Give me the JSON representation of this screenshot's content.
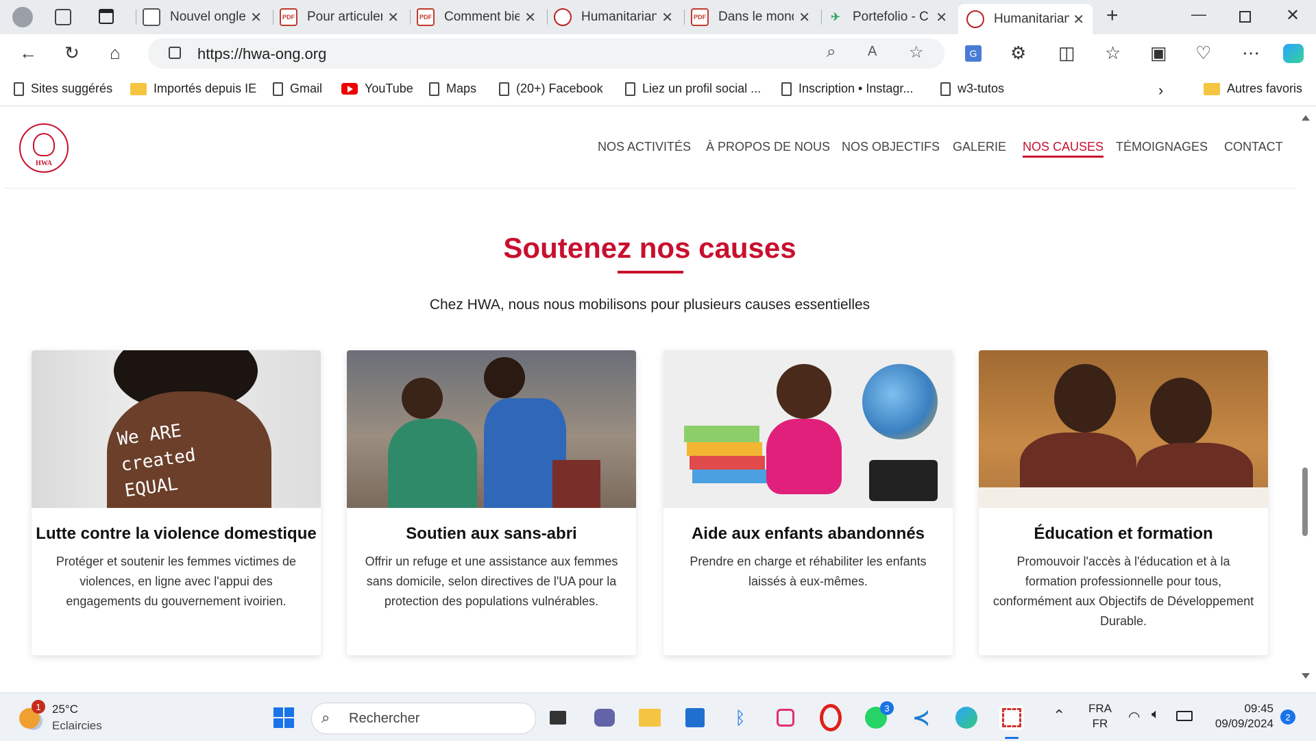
{
  "browser": {
    "tabs": [
      {
        "title": "Nouvel onglet",
        "icon": "new-tab-icon"
      },
      {
        "title": "Pour articuler",
        "icon": "pdf-icon"
      },
      {
        "title": "Comment bien",
        "icon": "pdf-icon"
      },
      {
        "title": "Humanitarian",
        "icon": "hwa-logo-icon"
      },
      {
        "title": "Dans le monde",
        "icon": "pdf-icon"
      },
      {
        "title": "Portefolio - C",
        "icon": "plane-icon"
      },
      {
        "title": "Humanitarian",
        "icon": "hwa-logo-icon",
        "active": true
      }
    ],
    "url": "https://hwa-ong.org",
    "bookmarks": [
      {
        "label": "Sites suggérés",
        "icon": "page-icon"
      },
      {
        "label": "Importés depuis IE",
        "icon": "folder-icon"
      },
      {
        "label": "Gmail",
        "icon": "page-icon"
      },
      {
        "label": "YouTube",
        "icon": "youtube-icon"
      },
      {
        "label": "Maps",
        "icon": "page-icon"
      },
      {
        "label": "(20+) Facebook",
        "icon": "page-icon"
      },
      {
        "label": "Liez un profil social ...",
        "icon": "page-icon"
      },
      {
        "label": "Inscription • Instagr...",
        "icon": "page-icon"
      },
      {
        "label": "w3-tutos",
        "icon": "page-icon"
      }
    ],
    "other_favorites": "Autres favoris"
  },
  "site": {
    "logo_text": "HWA",
    "nav": [
      "NOS ACTIVITÉS",
      "À PROPOS DE NOUS",
      "NOS OBJECTIFS",
      "GALERIE",
      "NOS CAUSES",
      "TÉMOIGNAGES",
      "CONTACT"
    ],
    "active_nav": "NOS CAUSES",
    "section_title": "Soutenez nos causes",
    "section_subtitle": "Chez HWA, nous nous mobilisons pour plusieurs causes essentielles",
    "cards": [
      {
        "title": "Lutte contre la violence domestique",
        "text": "Protéger et soutenir les femmes victimes de violences, en ligne avec l'appui des engagements du gouvernement ivoirien.",
        "image_text": "We ARE created EQUAL"
      },
      {
        "title": "Soutien aux sans-abri",
        "text": "Offrir un refuge et une assistance aux femmes sans domicile, selon directives de l'UA pour la protection des populations vulnérables."
      },
      {
        "title": "Aide aux enfants abandonnés",
        "text": "Prendre en charge et réhabiliter les enfants laissés à eux-mêmes."
      },
      {
        "title": "Éducation et formation",
        "text": "Promouvoir l'accès à l'éducation et à la formation professionnelle pour tous, conformément aux Objectifs de Développement Durable."
      }
    ]
  },
  "taskbar": {
    "weather_temp": "25°C",
    "weather_desc": "Eclaircies",
    "weather_badge": "1",
    "search_placeholder": "Rechercher",
    "whatsapp_badge": "3",
    "lang_top": "FRA",
    "lang_bottom": "FR",
    "time": "09:45",
    "date": "09/09/2024",
    "notif_count": "2"
  },
  "colors": {
    "accent": "#c8102e"
  }
}
